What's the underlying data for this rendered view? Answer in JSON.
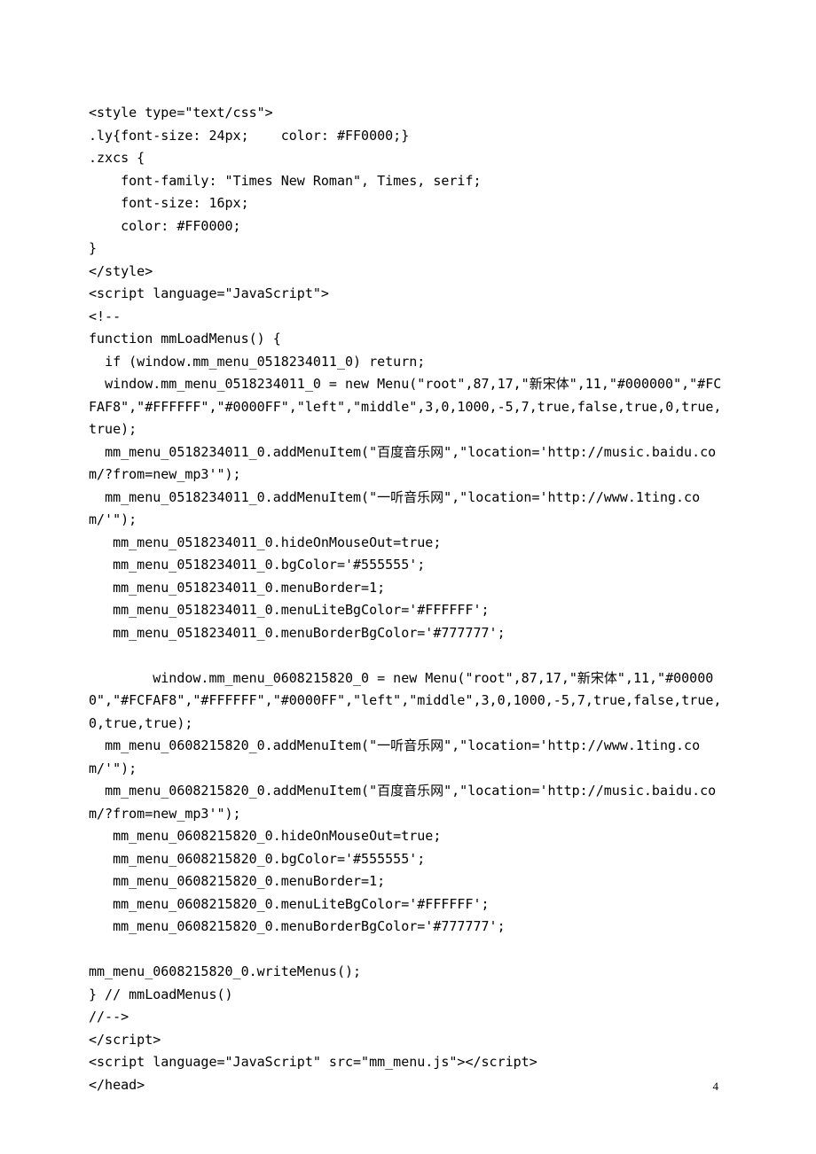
{
  "lines": [
    "<style type=\"text/css\">",
    ".ly{font-size: 24px;    color: #FF0000;}",
    ".zxcs {",
    "    font-family: \"Times New Roman\", Times, serif;",
    "    font-size: 16px;",
    "    color: #FF0000;",
    "}",
    "</style>",
    "<script language=\"JavaScript\">",
    "<!--",
    "function mmLoadMenus() {",
    "  if (window.mm_menu_0518234011_0) return;",
    "  window.mm_menu_0518234011_0 = new Menu(\"root\",87,17,\"新宋体\",11,\"#000000\",\"#FCFAF8\",\"#FFFFFF\",\"#0000FF\",\"left\",\"middle\",3,0,1000,-5,7,true,false,true,0,true,true);",
    "  mm_menu_0518234011_0.addMenuItem(\"百度音乐网\",\"location='http://music.baidu.com/?from=new_mp3'\");",
    "  mm_menu_0518234011_0.addMenuItem(\"一听音乐网\",\"location='http://www.1ting.com/'\");",
    "   mm_menu_0518234011_0.hideOnMouseOut=true;",
    "   mm_menu_0518234011_0.bgColor='#555555';",
    "   mm_menu_0518234011_0.menuBorder=1;",
    "   mm_menu_0518234011_0.menuLiteBgColor='#FFFFFF';",
    "   mm_menu_0518234011_0.menuBorderBgColor='#777777';",
    "",
    "        window.mm_menu_0608215820_0 = new Menu(\"root\",87,17,\"新宋体\",11,\"#000000\",\"#FCFAF8\",\"#FFFFFF\",\"#0000FF\",\"left\",\"middle\",3,0,1000,-5,7,true,false,true,0,true,true);",
    "  mm_menu_0608215820_0.addMenuItem(\"一听音乐网\",\"location='http://www.1ting.com/'\");",
    "  mm_menu_0608215820_0.addMenuItem(\"百度音乐网\",\"location='http://music.baidu.com/?from=new_mp3'\");",
    "   mm_menu_0608215820_0.hideOnMouseOut=true;",
    "   mm_menu_0608215820_0.bgColor='#555555';",
    "   mm_menu_0608215820_0.menuBorder=1;",
    "   mm_menu_0608215820_0.menuLiteBgColor='#FFFFFF';",
    "   mm_menu_0608215820_0.menuBorderBgColor='#777777';",
    "",
    "mm_menu_0608215820_0.writeMenus();",
    "} // mmLoadMenus()",
    "//-->",
    "</script>",
    "<script language=\"JavaScript\" src=\"mm_menu.js\"></script>",
    "</head>"
  ],
  "page_number": "4"
}
